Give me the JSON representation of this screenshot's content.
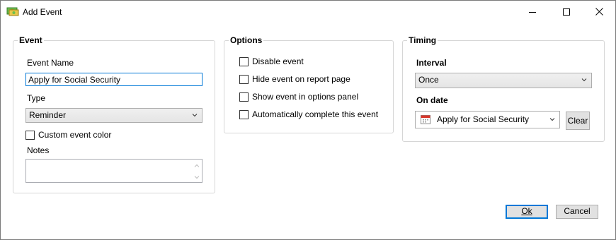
{
  "window": {
    "title": "Add Event"
  },
  "event_group": {
    "legend": "Event",
    "name_label": "Event Name",
    "name_value": "Apply for Social Security",
    "type_label": "Type",
    "type_value": "Reminder",
    "custom_color_label": "Custom event color",
    "custom_color_checked": false,
    "notes_label": "Notes",
    "notes_value": ""
  },
  "options_group": {
    "legend": "Options",
    "items": [
      {
        "label": "Disable event",
        "checked": false
      },
      {
        "label": "Hide event on report page",
        "checked": false
      },
      {
        "label": "Show event in options panel",
        "checked": false
      },
      {
        "label": "Automatically complete this event",
        "checked": false
      }
    ]
  },
  "timing_group": {
    "legend": "Timing",
    "interval_label": "Interval",
    "interval_value": "Once",
    "on_date_label": "On date",
    "on_date_value": "Apply for Social Security",
    "clear_label": "Clear"
  },
  "footer": {
    "ok_label": "Ok",
    "cancel_label": "Cancel"
  },
  "icons": {
    "app": "money-icon",
    "minimize": "minimize-icon",
    "maximize": "maximize-icon",
    "close": "close-icon",
    "dropdown": "chevron-down-icon",
    "calendar": "calendar-icon"
  },
  "colors": {
    "accent": "#0078d7",
    "group_border": "#d6d6d6"
  }
}
